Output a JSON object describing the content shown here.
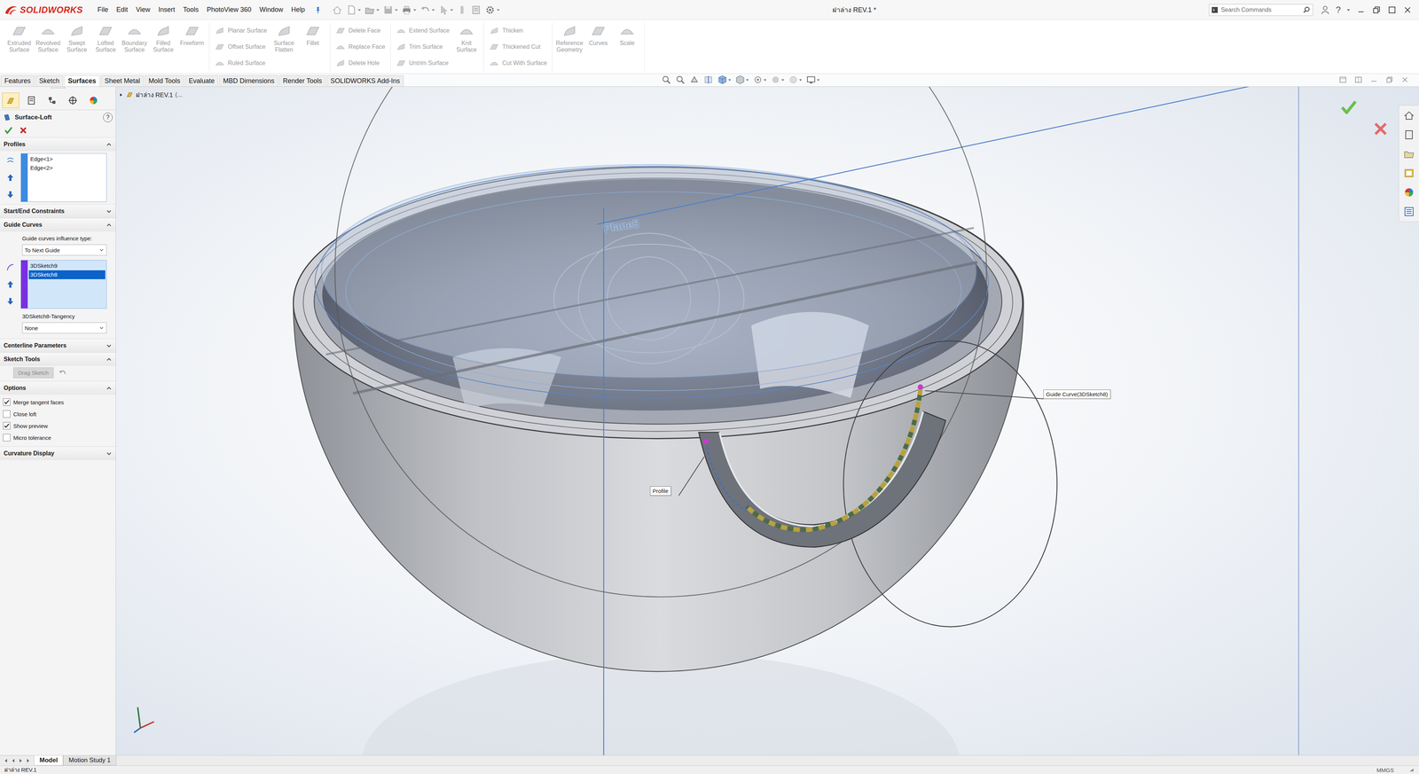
{
  "app": {
    "logo": "SOLIDWORKS"
  },
  "titlebar": {
    "title": "ฝาล่าง REV.1 *",
    "help": "?"
  },
  "menus": [
    "File",
    "Edit",
    "View",
    "Insert",
    "Tools",
    "PhotoView 360",
    "Window",
    "Help"
  ],
  "search": {
    "placeholder": "Search Commands"
  },
  "ribbon": {
    "groups": [
      {
        "items": [
          {
            "label": "Extruded Surface",
            "kind": "large",
            "disabled": true
          },
          {
            "label": "Revolved Surface",
            "kind": "large",
            "disabled": true
          },
          {
            "label": "Swept Surface",
            "kind": "large",
            "disabled": true
          },
          {
            "label": "Lofted Surface",
            "kind": "large",
            "disabled": true
          },
          {
            "label": "Boundary Surface",
            "kind": "large",
            "disabled": true
          },
          {
            "label": "Filled Surface",
            "kind": "large",
            "disabled": true
          },
          {
            "label": "Freeform",
            "kind": "large",
            "disabled": true
          }
        ]
      },
      {
        "items": [
          {
            "label": "Planar Surface",
            "kind": "small",
            "disabled": true
          },
          {
            "label": "Offset Surface",
            "kind": "small",
            "disabled": true
          },
          {
            "label": "Ruled Surface",
            "kind": "small",
            "disabled": true
          },
          {
            "label": "Surface Flatten",
            "kind": "large",
            "disabled": true
          },
          {
            "label": "Fillet",
            "kind": "large",
            "disabled": true
          }
        ]
      },
      {
        "items": [
          {
            "label": "Delete Face",
            "kind": "small",
            "disabled": true
          },
          {
            "label": "Replace Face",
            "kind": "small",
            "disabled": true
          },
          {
            "label": "Delete Hole",
            "kind": "small",
            "disabled": true
          }
        ]
      },
      {
        "items": [
          {
            "label": "Extend Surface",
            "kind": "small",
            "disabled": true
          },
          {
            "label": "Trim Surface",
            "kind": "small",
            "disabled": true
          },
          {
            "label": "Untrim Surface",
            "kind": "small",
            "disabled": true
          },
          {
            "label": "Knit Surface",
            "kind": "large",
            "disabled": true
          }
        ]
      },
      {
        "items": [
          {
            "label": "Thicken",
            "kind": "small",
            "disabled": true
          },
          {
            "label": "Thickened Cut",
            "kind": "small",
            "disabled": true
          },
          {
            "label": "Cut With Surface",
            "kind": "small",
            "disabled": true
          }
        ]
      },
      {
        "items": [
          {
            "label": "Reference Geometry",
            "kind": "large",
            "disabled": true
          },
          {
            "label": "Curves",
            "kind": "large",
            "disabled": true
          },
          {
            "label": "Scale",
            "kind": "large",
            "disabled": true
          }
        ]
      }
    ]
  },
  "command_tabs": [
    {
      "label": "Features",
      "selected": false
    },
    {
      "label": "Sketch",
      "selected": false
    },
    {
      "label": "Surfaces",
      "selected": true
    },
    {
      "label": "Sheet Metal",
      "selected": false
    },
    {
      "label": "Mold Tools",
      "selected": false
    },
    {
      "label": "Evaluate",
      "selected": false
    },
    {
      "label": "MBD Dimensions",
      "selected": false
    },
    {
      "label": "Render Tools",
      "selected": false
    },
    {
      "label": "SOLIDWORKS Add-Ins",
      "selected": false
    }
  ],
  "property_manager": {
    "title": "Surface-Loft",
    "help": "?",
    "panel_tabs": [
      {
        "selected": true
      },
      {
        "selected": false
      },
      {
        "selected": false
      },
      {
        "selected": false
      },
      {
        "selected": false
      }
    ],
    "profiles": {
      "title": "Profiles",
      "expanded": true,
      "items": [
        {
          "label": "Edge<1>",
          "selected": false
        },
        {
          "label": "Edge<2>",
          "selected": false
        }
      ]
    },
    "start_end": {
      "title": "Start/End Constraints",
      "expanded": false
    },
    "guide_curves": {
      "title": "Guide Curves",
      "expanded": true,
      "influence_label": "Guide curves influence type:",
      "influence_value": "To Next Guide",
      "items": [
        {
          "label": "3DSketch9",
          "selected": false
        },
        {
          "label": "3DSketch8",
          "selected": true
        }
      ],
      "tangency_label": "3DSketch8-Tangency",
      "tangency_value": "None"
    },
    "centerline": {
      "title": "Centerline Parameters",
      "expanded": false
    },
    "sketch_tools": {
      "title": "Sketch Tools",
      "expanded": true,
      "button": {
        "label": "Drag Sketch",
        "disabled": true
      }
    },
    "options": {
      "title": "Options",
      "expanded": true,
      "checkboxes": [
        {
          "label": "Merge tangent faces",
          "checked": true
        },
        {
          "label": "Close loft",
          "checked": false
        },
        {
          "label": "Show preview",
          "checked": true
        },
        {
          "label": "Micro tolerance",
          "checked": false
        }
      ]
    },
    "curvature": {
      "title": "Curvature Display",
      "expanded": false
    }
  },
  "feature_tree": {
    "root": "ฝาล่าง REV.1",
    "suffix": "(..."
  },
  "viewport": {
    "plane": "Plane5",
    "profile_callout": "Profile",
    "guide_callout": "Guide Curve(3DSketch8)"
  },
  "bottom_tabs": [
    {
      "label": "Model",
      "selected": true
    },
    {
      "label": "Motion Study 1",
      "selected": false
    }
  ],
  "status_bar": {
    "document": "ฝาล่าง REV.1",
    "units": "MMGS"
  }
}
